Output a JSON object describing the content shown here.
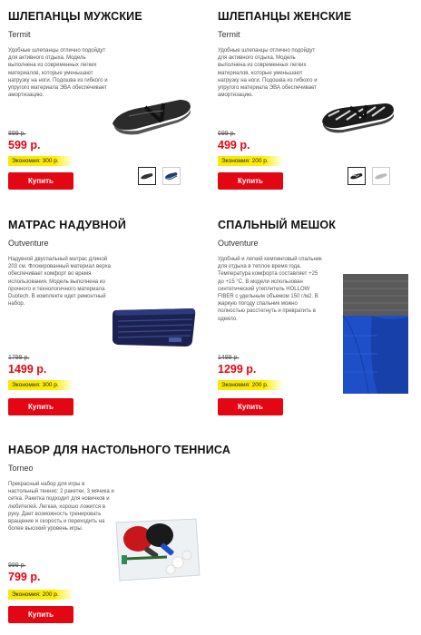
{
  "products": [
    {
      "title": "ШЛЕПАНЦЫ МУЖСКИЕ",
      "brand": "Termit",
      "description": "Удобные шлепанцы отлично подойдут для активного отдыха. Модель выполнена из современных легких материалов, которые уменьшают нагрузку на ноги. Подошва из гибкого и упругого материала ЭВА обеспечивает амортизацию.",
      "old_price": "899 р.",
      "price": "599 р.",
      "savings": "Экономия: 300 р.",
      "buy_label": "Купить"
    },
    {
      "title": "ШЛЕПАНЦЫ ЖЕНСКИЕ",
      "brand": "Termit",
      "description": "Удобные шлепанцы отлично подойдут для активного отдыха. Модель выполнена из современных легких материалов, которые уменьшают нагрузку на ноги. Подошва из гибкого и упругого материала ЭВА обеспечивает амортизацию.",
      "old_price": "699 р.",
      "price": "499 р.",
      "savings": "Экономия: 200 р.",
      "buy_label": "Купить"
    },
    {
      "title": "МАТРАС НАДУВНОЙ",
      "brand": "Outventure",
      "description": "Надувной двуспальный матрас длиной 203 см. Флокированный материал верха обеспечивает комфорт во время использования. Модель выполнена из прочного и технологичного материала Duotech. В комплекте идет ремонтный набор.",
      "old_price": "1799 р.",
      "price": "1499 р.",
      "savings": "Экономия: 300 р.",
      "buy_label": "Купить"
    },
    {
      "title": "СПАЛЬНЫЙ МЕШОК",
      "brand": "Outventure",
      "description": "Удобный и легкий кемпинговый спальник для отдыха в теплое время года. Температура комфорта составляет +25 до +15 °С. В модели использован синтетический утеплитель HOLLOW FIBER с удельным объемом 150 г/м2. В жаркую погоду спальник можно полностью расстегнуть и превратить в одеяло.",
      "old_price": "1499 р.",
      "price": "1299 р.",
      "savings": "Экономия: 200 р.",
      "buy_label": "Купить"
    },
    {
      "title": "НАБОР ДЛЯ НАСТОЛЬНОГО ТЕННИСА",
      "brand": "Torneo",
      "description": "Прекрасный набор для игры в настольный теннис: 2 ракетки, 3 мячика и сетка. Ракетка подходит для новичков и любителей. Легкая, хорошо ложится в руку. Дает возможность тренировать вращение и скорость и переходить на более высокий уровень игры.",
      "old_price": "999 р.",
      "price": "799 р.",
      "savings": "Экономия: 200 р.",
      "buy_label": "Купить"
    }
  ],
  "colors": {
    "accent_red": "#e30613",
    "savings_yellow": "#ffee00"
  }
}
